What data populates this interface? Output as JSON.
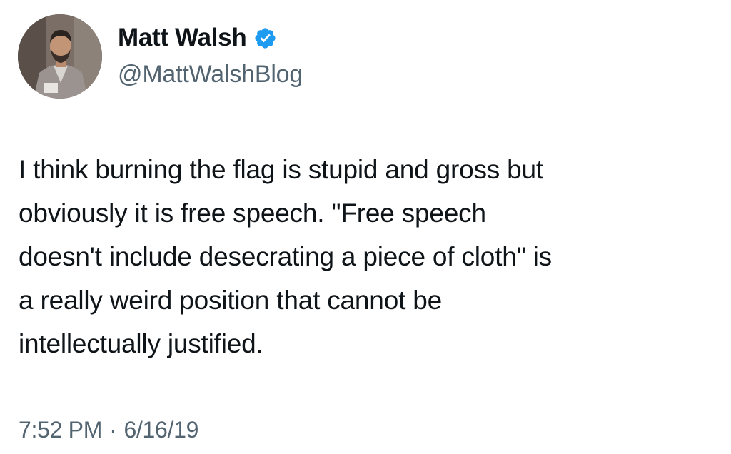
{
  "author": {
    "display_name": "Matt Walsh",
    "handle": "@MattWalshBlog",
    "verified": true
  },
  "tweet": {
    "lines": [
      "I think burning the flag is stupid and gross but",
      "obviously it is free speech. \"Free speech",
      "doesn't include desecrating a piece of cloth\" is",
      "a really weird position that cannot be",
      "intellectually justified."
    ]
  },
  "meta": {
    "time": "7:52 PM",
    "separator": "·",
    "date": "6/16/19"
  },
  "colors": {
    "text": "#0f1419",
    "secondary": "#536471",
    "verified": "#1d9bf0"
  },
  "icons": {
    "avatar": "profile-photo",
    "badge": "verified-badge-icon"
  }
}
